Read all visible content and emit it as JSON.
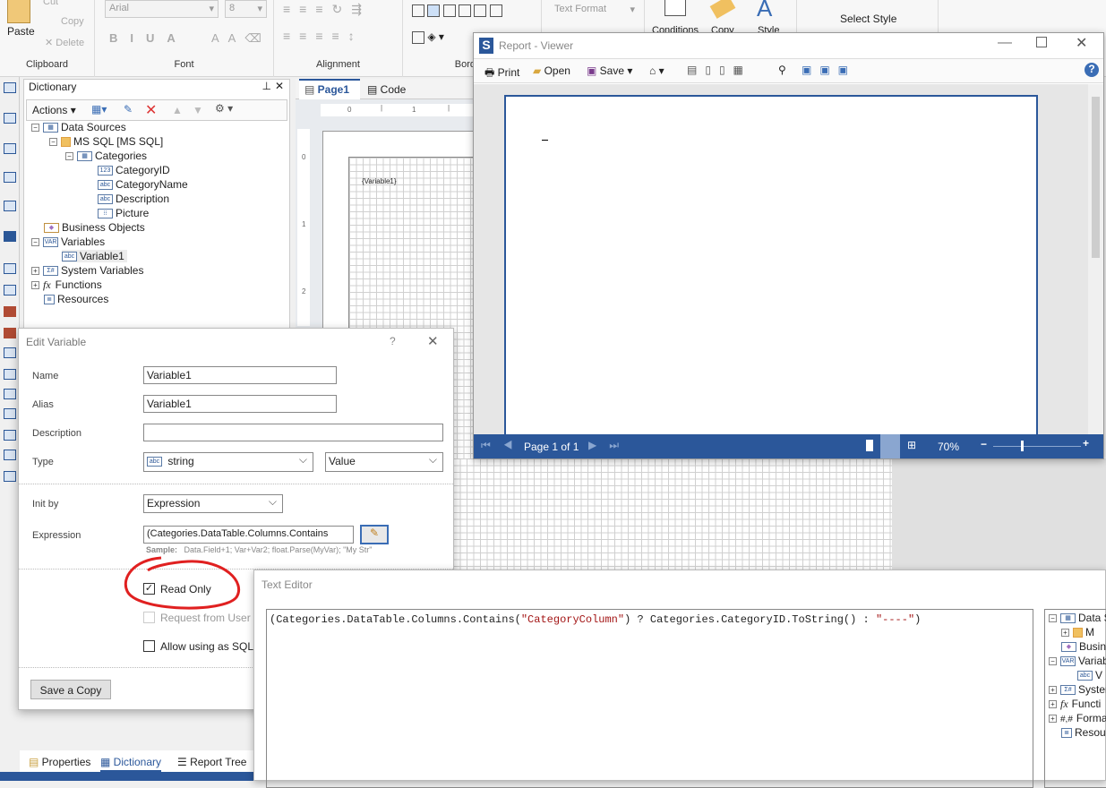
{
  "ribbon": {
    "clipboard": {
      "paste": "Paste",
      "cut": "Cut",
      "copy": "Copy",
      "delete": "Delete",
      "label": "Clipboard"
    },
    "font": {
      "family": "Arial",
      "size": "8",
      "label": "Font"
    },
    "alignment": {
      "label": "Alignment"
    },
    "borders": {
      "label": "Borders"
    },
    "text_format": {
      "value": "Text Format"
    },
    "style": {
      "conditions": "Conditions",
      "copy": "Copy",
      "style": "Style"
    },
    "select_style": "Select Style"
  },
  "dictionary": {
    "title": "Dictionary",
    "actions": "Actions",
    "tree": [
      {
        "label": "Data Sources",
        "icon": "table"
      },
      {
        "label": "MS SQL [MS SQL]",
        "icon": "database"
      },
      {
        "label": "Categories",
        "icon": "table"
      },
      {
        "label": "CategoryID",
        "icon": "123"
      },
      {
        "label": "CategoryName",
        "icon": "abc"
      },
      {
        "label": "Description",
        "icon": "abc"
      },
      {
        "label": "Picture",
        "icon": "image"
      },
      {
        "label": "Business Objects",
        "icon": "business-objects"
      },
      {
        "label": "Variables",
        "icon": "VAR"
      },
      {
        "label": "Variable1",
        "icon": "abc"
      },
      {
        "label": "System Variables",
        "icon": "Σ#"
      },
      {
        "label": "Functions",
        "icon": "fx"
      },
      {
        "label": "Resources",
        "icon": "resources"
      }
    ],
    "bottom_tabs": [
      "Properties",
      "Dictionary",
      "Report Tree"
    ],
    "active_tab": "Dictionary"
  },
  "designer": {
    "tabs": [
      "Page1",
      "Code"
    ],
    "ruler_h": [
      "0",
      "1"
    ],
    "ruler_v": [
      "0",
      "1",
      "2"
    ],
    "component_text": "{Variable1}"
  },
  "viewer": {
    "title": "Report - Viewer",
    "toolbar": {
      "print": "Print",
      "open": "Open",
      "save": "Save"
    },
    "page_info": "Page 1 of 1",
    "zoom": "70%",
    "zoom_level": 0.7,
    "accent": "#2b579a"
  },
  "edit_variable": {
    "title": "Edit Variable",
    "help": "?",
    "name_label": "Name",
    "name": "Variable1",
    "alias_label": "Alias",
    "alias": "Variable1",
    "description_label": "Description",
    "description": "",
    "type_label": "Type",
    "type": "string",
    "type_icon": "abc",
    "kind": "Value",
    "init_by_label": "Init by",
    "init_by": "Expression",
    "expression_label": "Expression",
    "expression": "(Categories.DataTable.Columns.Contains",
    "sample_label": "Sample:",
    "sample": "Data.Field+1; Var+Var2; float.Parse(MyVar); \"My Str\"",
    "read_only": {
      "label": "Read Only",
      "checked": true
    },
    "request_from_user": {
      "label": "Request from User",
      "checked": false,
      "enabled": false
    },
    "allow_sql": {
      "label": "Allow using as SQL pa",
      "checked": false
    },
    "save_copy": "Save a Copy",
    "annotation_color": "#e02020"
  },
  "text_editor": {
    "title": "Text Editor",
    "code_parts": [
      "(Categories.DataTable.Columns.Contains(",
      "\"CategoryColumn\"",
      ") ? Categories.CategoryID.ToString() : ",
      "\"----\"",
      ")"
    ],
    "tree": [
      {
        "label": "Data S"
      },
      {
        "label": "M"
      },
      {
        "label": "Busine"
      },
      {
        "label": "Variab"
      },
      {
        "label": "V"
      },
      {
        "label": "Syster"
      },
      {
        "label": "Functi"
      },
      {
        "label": "Forma"
      },
      {
        "label": "Resou"
      }
    ]
  }
}
